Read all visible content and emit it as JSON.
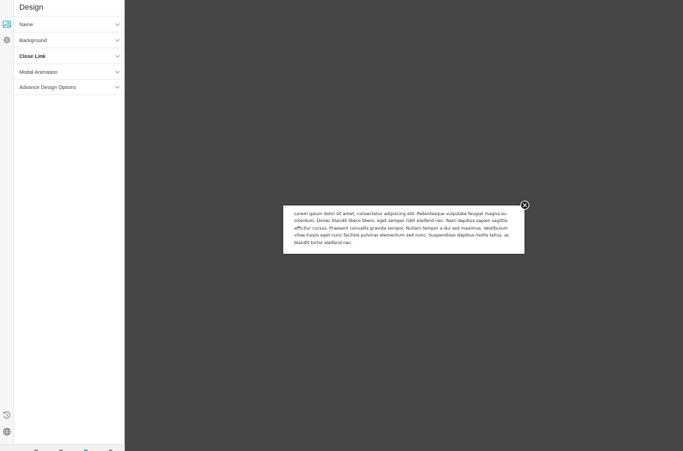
{
  "panel": {
    "title": "Design",
    "sections": [
      {
        "label": "Name",
        "bold": false
      },
      {
        "label": "Background",
        "bold": false
      },
      {
        "label": "Close Link",
        "bold": true
      },
      {
        "label": "Modal Animation",
        "bold": false
      },
      {
        "label": "Advance Design Options",
        "bold": false
      }
    ]
  },
  "rail": {
    "icons": [
      "image-icon",
      "gear-icon",
      "history-icon",
      "globe-icon"
    ],
    "active_color": "#2ea2cc"
  },
  "modal": {
    "text": "Lorem ipsum dolor sit amet, consectetur adipiscing elit. Pellentesque vulputate feugiat magna eu interdum. Donec blandit libero libero, eget semper nibh eleifend nec. Nam dapibus sapien sagittis efficitur cursus. Praesent convallis gravida tempor. Nullam tempor a dui sed maximus. Vestibulum vitae turpis eget nunc facilisis pulvinar elementum sed nunc. Suspendisse dapibus mollis tellus, ac blandit tortor eleifend nec.",
    "close_icon": "close-icon"
  },
  "colors": {
    "canvas_bg": "#464646",
    "panel_bg": "#ffffff",
    "accent": "#2ea2cc"
  }
}
